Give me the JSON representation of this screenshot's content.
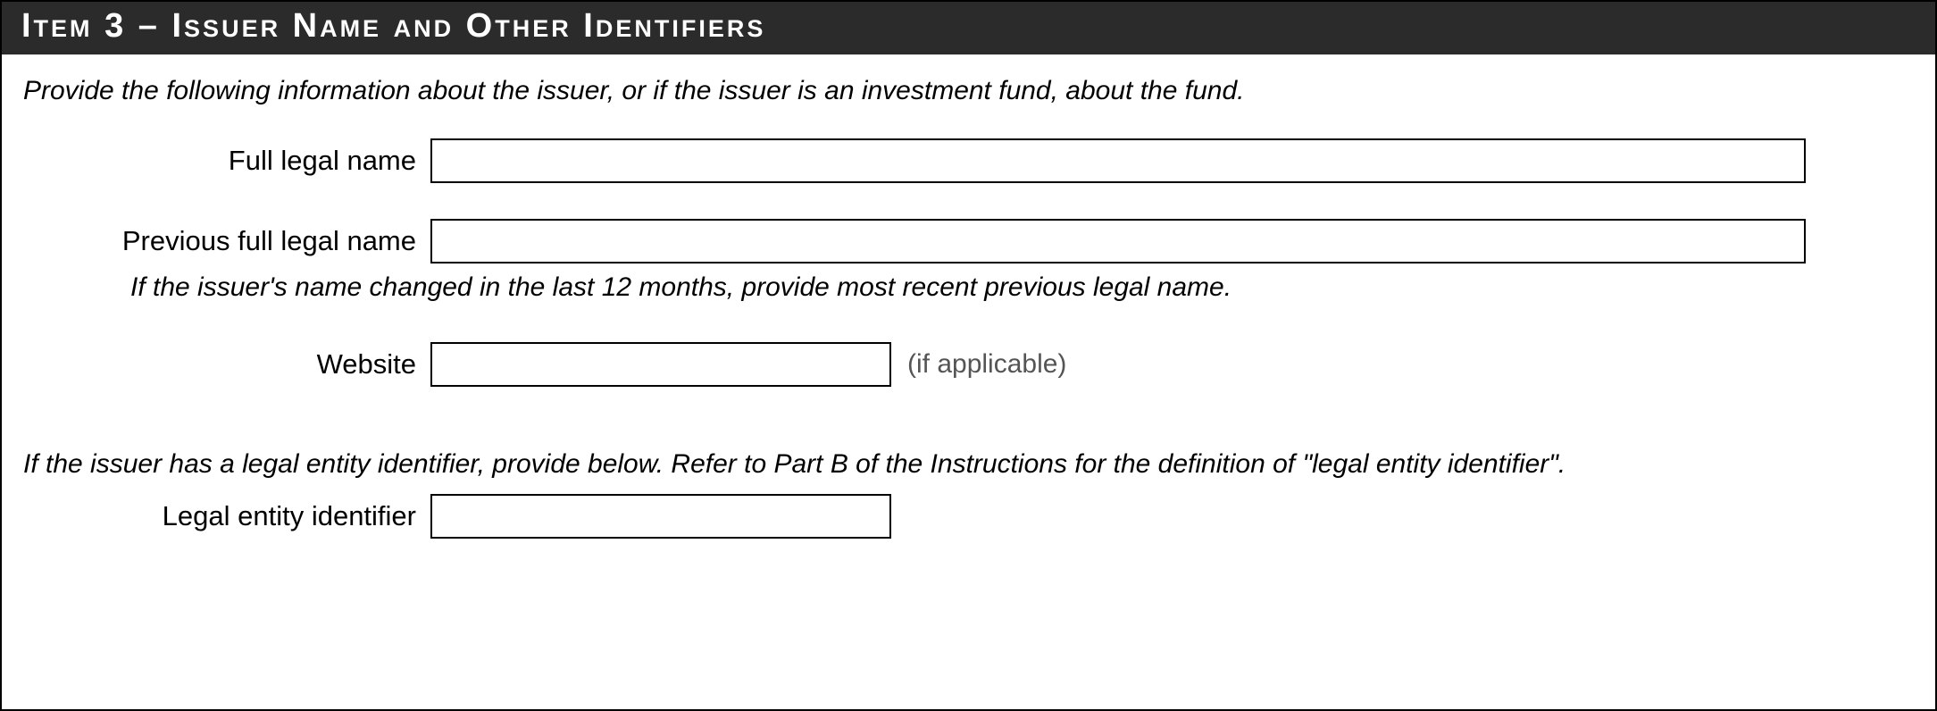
{
  "header": {
    "title": "Item 3 – Issuer Name and Other Identifiers"
  },
  "section": {
    "intro": "Provide the following information about the issuer, or if the issuer is an investment fund, about the fund.",
    "fields": {
      "full_legal_name": {
        "label": "Full legal name",
        "value": ""
      },
      "previous_full_legal_name": {
        "label": "Previous full legal name",
        "value": "",
        "helper": "If the issuer's name changed in the last 12 months, provide most recent previous legal name."
      },
      "website": {
        "label": "Website",
        "value": "",
        "note": "(if applicable)"
      },
      "lei_intro": "If the issuer has a legal entity identifier, provide below. Refer to Part B of the Instructions for the definition of \"legal entity identifier\".",
      "legal_entity_identifier": {
        "label": "Legal entity identifier",
        "value": ""
      }
    }
  }
}
